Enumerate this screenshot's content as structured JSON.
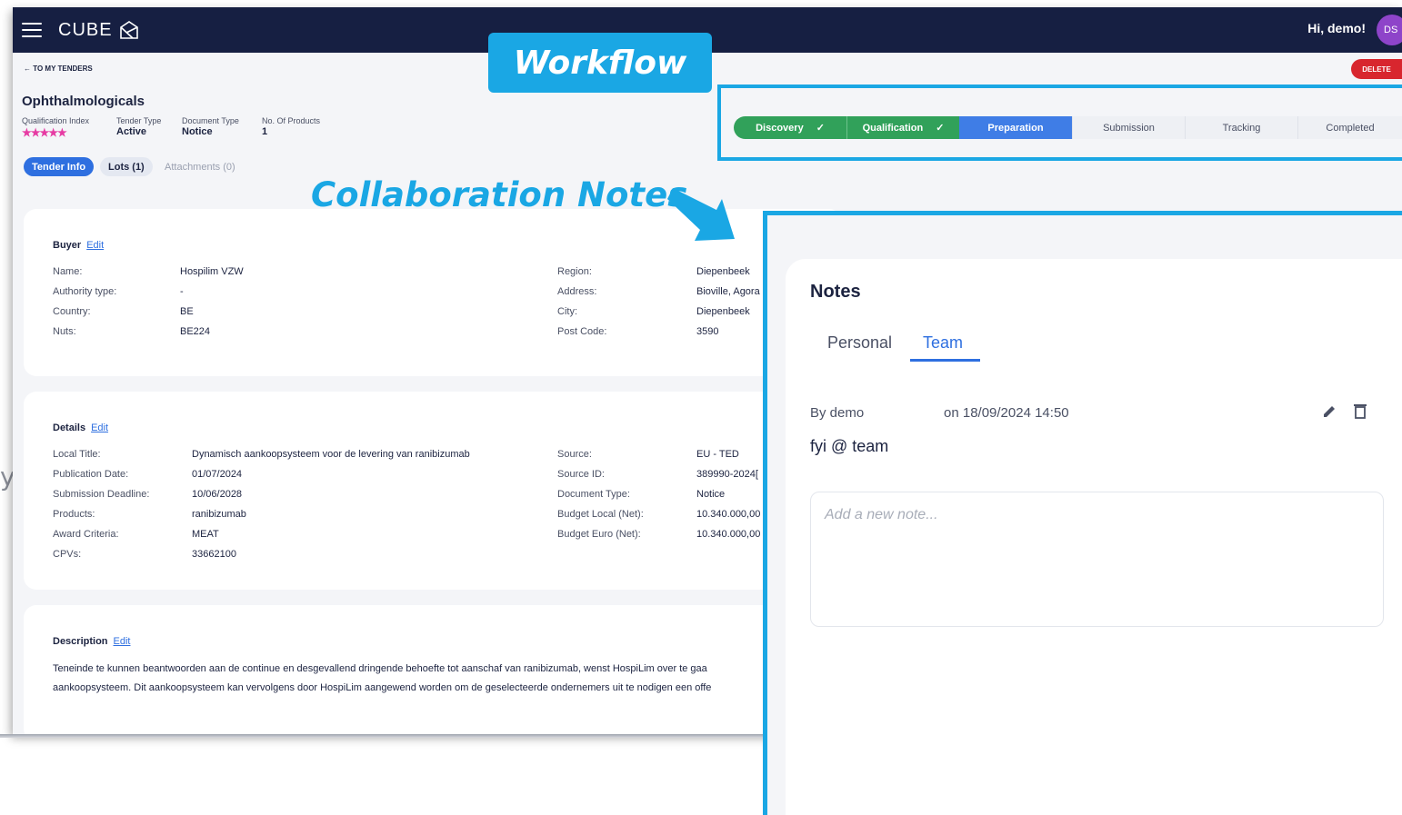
{
  "side_letter": "y",
  "topbar": {
    "brand": "CUBE",
    "greeting": "Hi, demo!",
    "avatar_initials": "DS"
  },
  "header": {
    "back_link": "← TO MY TENDERS",
    "delete_label": "DELETE",
    "title": "Ophthalmologicals",
    "meta": [
      {
        "label": "Qualification Index",
        "value": "★★★★★"
      },
      {
        "label": "Tender Type",
        "value": "Active"
      },
      {
        "label": "Document Type",
        "value": "Notice"
      },
      {
        "label": "No. Of Products",
        "value": "1"
      }
    ]
  },
  "tabs": [
    "Tender Info",
    "Lots (1)",
    "Attachments (0)"
  ],
  "edit_label": "Edit",
  "buyer": {
    "title": "Buyer",
    "left": [
      {
        "label": "Name:",
        "value": "Hospilim VZW"
      },
      {
        "label": "Authority type:",
        "value": "-"
      },
      {
        "label": "Country:",
        "value": "BE"
      },
      {
        "label": "Nuts:",
        "value": "BE224"
      }
    ],
    "right": [
      {
        "label": "Region:",
        "value": "Diepenbeek"
      },
      {
        "label": "Address:",
        "value": "Bioville, Agora"
      },
      {
        "label": "City:",
        "value": "Diepenbeek"
      },
      {
        "label": "Post Code:",
        "value": "3590"
      }
    ]
  },
  "details": {
    "title": "Details",
    "left": [
      {
        "label": "Local Title:",
        "value": "Dynamisch aankoopsysteem voor de levering van ranibizumab"
      },
      {
        "label": "Publication Date:",
        "value": "01/07/2024"
      },
      {
        "label": "Submission Deadline:",
        "value": "10/06/2028"
      },
      {
        "label": "Products:",
        "value": "ranibizumab"
      },
      {
        "label": "Award Criteria:",
        "value": "MEAT"
      },
      {
        "label": "CPVs:",
        "value": "33662100"
      }
    ],
    "right": [
      {
        "label": "Source:",
        "value": "EU - TED"
      },
      {
        "label": "Source ID:",
        "value": "389990-2024["
      },
      {
        "label": "Document Type:",
        "value": "Notice"
      },
      {
        "label": "Budget Local (Net):",
        "value": "10.340.000,00"
      },
      {
        "label": "Budget Euro (Net):",
        "value": "10.340.000,00"
      }
    ]
  },
  "description": {
    "title": "Description",
    "line1": "Teneinde te kunnen beantwoorden aan de continue en desgevallend dringende behoefte tot aanschaf van ranibizumab, wenst HospiLim over te gaa",
    "line2": "aankoopsysteem. Dit aankoopsysteem kan vervolgens door HospiLim aangewend worden om de geselecteerde ondernemers uit te nodigen een offe"
  },
  "workflow": {
    "callout": "Workflow",
    "steps": [
      {
        "label": "Discovery",
        "state": "done",
        "check": "✓"
      },
      {
        "label": "Qualification",
        "state": "done",
        "check": "✓"
      },
      {
        "label": "Preparation",
        "state": "active"
      },
      {
        "label": "Submission",
        "state": "todo"
      },
      {
        "label": "Tracking",
        "state": "todo"
      },
      {
        "label": "Completed",
        "state": "todo"
      }
    ]
  },
  "collab_callout": "Collaboration Notes",
  "notes": {
    "title": "Notes",
    "tabs": {
      "personal": "Personal",
      "team": "Team"
    },
    "entry": {
      "by": "By demo",
      "date": "on 18/09/2024 14:50",
      "text": "fyi @ team"
    },
    "placeholder": "Add a new note..."
  },
  "colors": {
    "navy": "#161f42",
    "accent": "#1aa7e4",
    "done": "#31a15a",
    "active": "#3f7de6",
    "delete": "#d8262e",
    "stars": "#e63ba3"
  }
}
